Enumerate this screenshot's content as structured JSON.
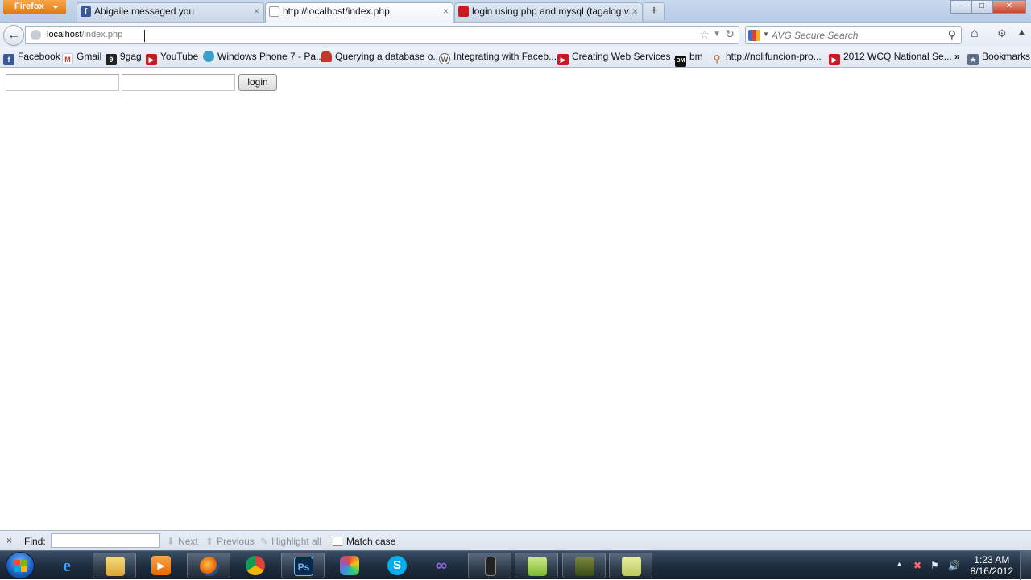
{
  "browser": {
    "menu_label": "Firefox",
    "tabs": [
      {
        "title": "Abigaile messaged you",
        "favicon": "facebook-icon",
        "active": false
      },
      {
        "title": "http://localhost/index.php",
        "favicon": "blank-page-icon",
        "active": true
      },
      {
        "title": "login using php and mysql (tagalog v...",
        "favicon": "youtube-icon",
        "active": false
      }
    ],
    "new_tab_label": "+",
    "close_tab_glyph": "×"
  },
  "navbar": {
    "url_host": "localhost",
    "url_path": "/index.php",
    "search_placeholder": "AVG Secure Search"
  },
  "bookmarks": [
    {
      "label": "Facebook",
      "icon": "facebook-icon"
    },
    {
      "label": "Gmail",
      "icon": "gmail-icon"
    },
    {
      "label": "9gag",
      "icon": "9gag-icon"
    },
    {
      "label": "YouTube",
      "icon": "youtube-icon"
    },
    {
      "label": "Windows Phone 7 - Pa...",
      "icon": "globe-icon"
    },
    {
      "label": "Querying a database o...",
      "icon": "mushroom-icon"
    },
    {
      "label": "Integrating with Faceb...",
      "icon": "wordpress-icon"
    },
    {
      "label": "Creating Web Services ...",
      "icon": "youtube-icon"
    },
    {
      "label": "bm",
      "icon": "bm-icon"
    },
    {
      "label": "http://nolifuncion-pro...",
      "icon": "pin-icon"
    },
    {
      "label": "2012 WCQ National Se...",
      "icon": "youtube-icon"
    },
    {
      "label": "Bookmarks",
      "icon": "bookmarks-icon"
    }
  ],
  "bookmarks_overflow": "»",
  "page": {
    "username_value": "",
    "password_value": "",
    "login_label": "login"
  },
  "findbar": {
    "close_glyph": "×",
    "label": "Find:",
    "query": "",
    "next_label": "Next",
    "previous_label": "Previous",
    "highlight_label": "Highlight all",
    "match_case_label": "Match case"
  },
  "taskbar": {
    "apps": [
      "internet-explorer-icon",
      "file-explorer-icon",
      "media-player-icon",
      "firefox-icon",
      "chrome-icon",
      "photoshop-icon",
      "picasa-icon",
      "skype-icon",
      "visual-studio-icon",
      "phone-emulator-icon",
      "notepad-plus-icon",
      "camtasia-icon",
      "sticky-notes-icon"
    ],
    "clock_time": "1:23 AM",
    "clock_date": "8/16/2012"
  },
  "colors": {
    "firefox_orange": "#e0780f",
    "facebook_blue": "#3b5998",
    "youtube_red": "#cc181e",
    "taskbar_dark": "#1d2c3d"
  }
}
